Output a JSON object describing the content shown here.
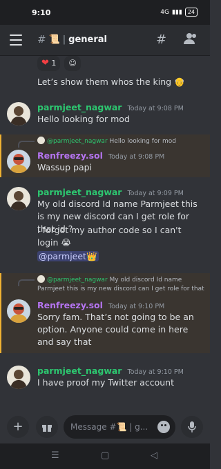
{
  "status": {
    "time": "9:10",
    "signal": "4G",
    "battery": "24"
  },
  "header": {
    "channel_emoji": "📜",
    "separator": "|",
    "channel_name": "general"
  },
  "reactions": [
    {
      "emoji": "❤",
      "count": "1"
    }
  ],
  "top_message": {
    "text": "Let’s show them whos the king 👴"
  },
  "messages": [
    {
      "author": "parmjeet_nagwar",
      "time": "Today at 9:08 PM",
      "text": "Hello looking for mod"
    },
    {
      "reply_author": "@parmjeet_nagwar",
      "reply_text": "Hello looking for mod",
      "author": "Renfreezy.sol",
      "time": "Today at 9:08 PM",
      "text": "Wassup papi"
    },
    {
      "author": "parmjeet_nagwar",
      "time": "Today at 9:09 PM",
      "text": "My old discord Id name Parmjeet this is my new discord can I get role for that id ?",
      "text2": "I forgot my author code so I can't login 😭",
      "mention": "@parmjeet👑"
    },
    {
      "reply_author": "@parmjeet_nagwar",
      "reply_text": "My old discord Id name Parmjeet this is my new discord can I get role for that",
      "author": "Renfreezy.sol",
      "time": "Today at 9:10 PM",
      "text": "Sorry fam. That’s not going to be an option. Anyone could come in here and say that"
    },
    {
      "author": "parmjeet_nagwar",
      "time": "Today at 9:10 PM",
      "text": "I have proof my Twitter account"
    }
  ],
  "composer": {
    "placeholder": "Message #📜 | g..."
  },
  "colors": {
    "background": "#313338",
    "green_name": "#2dc770",
    "purple_name": "#b574f0",
    "highlight": "#f0b232"
  }
}
